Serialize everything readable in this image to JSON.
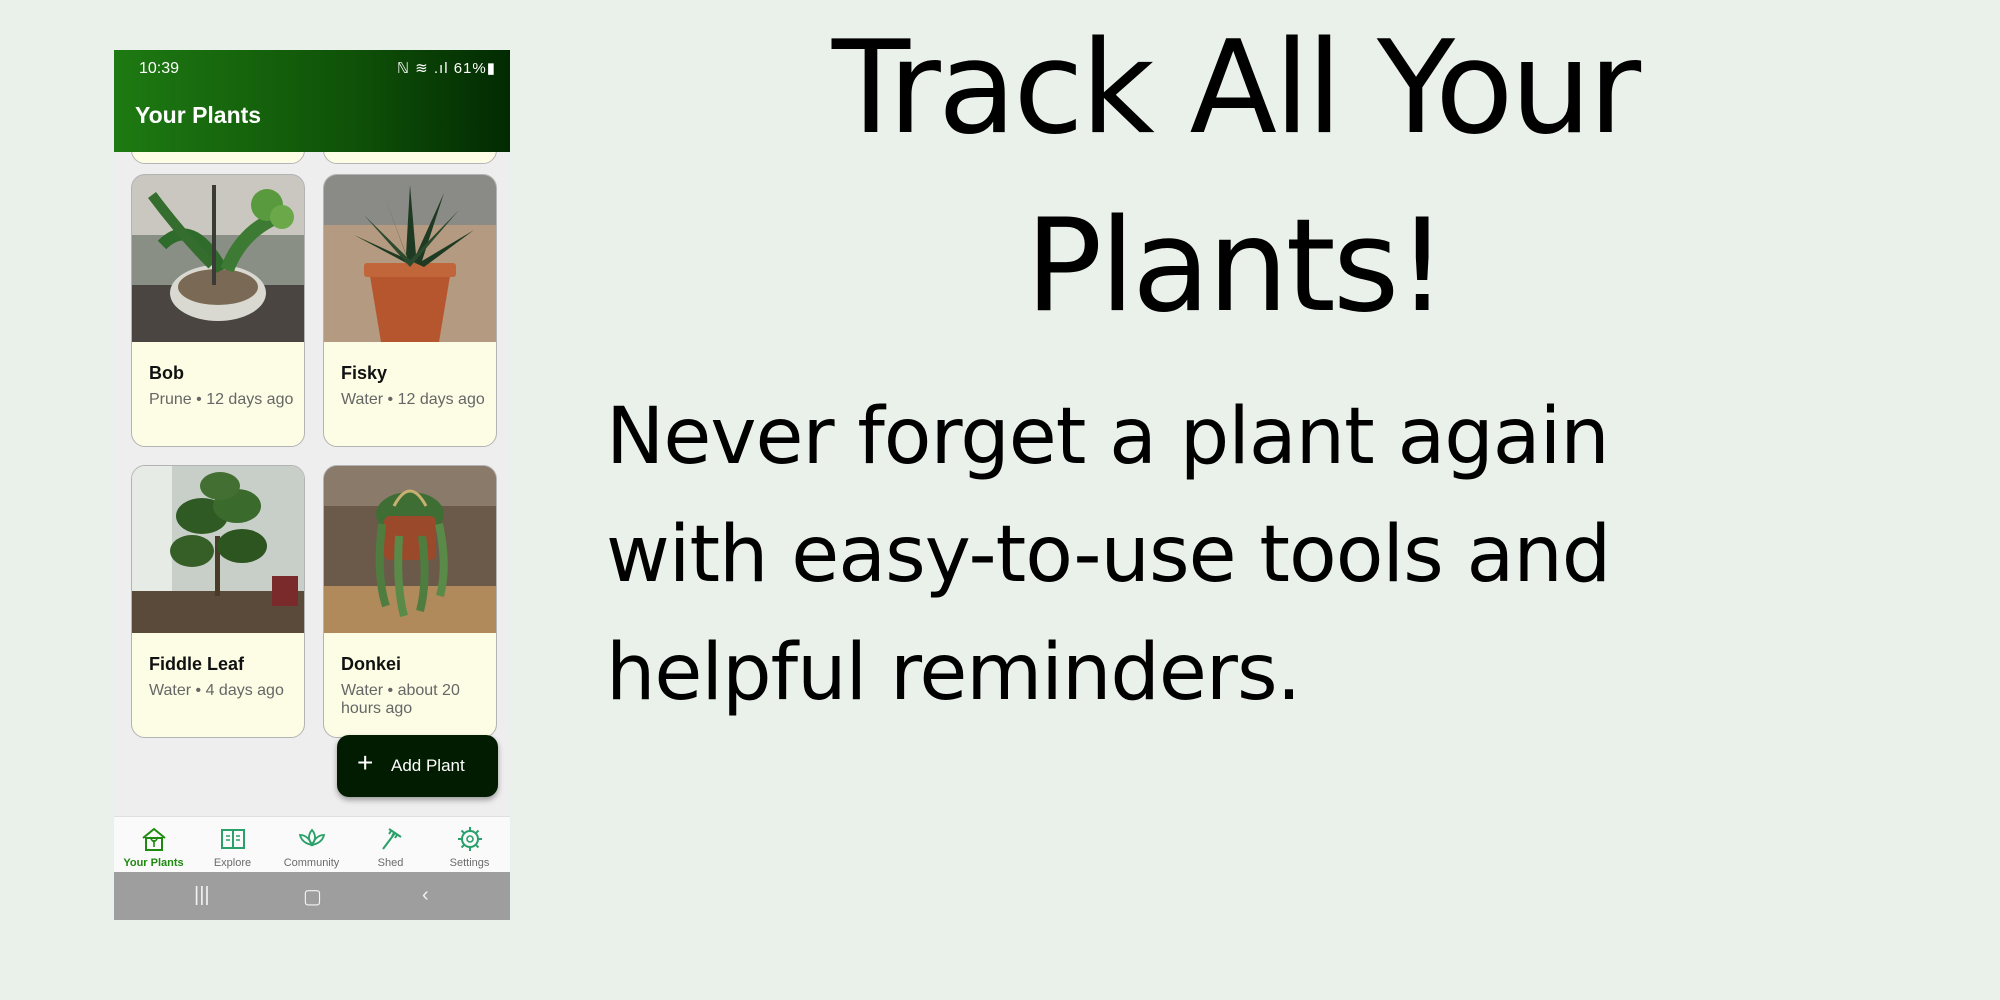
{
  "status_bar": {
    "time": "10:39",
    "icons": "ℕ ≋ .ıl 61%▮"
  },
  "app": {
    "title": "Your Plants"
  },
  "plants": [
    {
      "name": "Bob",
      "subtitle": "Prune • 12 days ago"
    },
    {
      "name": "Fisky",
      "subtitle": "Water • 12 days ago"
    },
    {
      "name": "Fiddle Leaf",
      "subtitle": "Water • 4 days ago"
    },
    {
      "name": "Donkei",
      "subtitle": "Water • about 20 hours ago"
    }
  ],
  "fab": {
    "icon": "+",
    "label": "Add Plant"
  },
  "nav": [
    {
      "label": "Your Plants",
      "icon": "house-plant-icon",
      "active": true
    },
    {
      "label": "Explore",
      "icon": "book-icon"
    },
    {
      "label": "Community",
      "icon": "lotus-icon"
    },
    {
      "label": "Shed",
      "icon": "rake-icon"
    },
    {
      "label": "Settings",
      "icon": "gear-icon"
    }
  ],
  "system_nav": {
    "recents": "|||",
    "home": "▢",
    "back": "‹"
  },
  "headline": {
    "line1": "Track All Your",
    "line2": "Plants!"
  },
  "subline": {
    "line1": "Never forget a plant again",
    "line2": "with easy-to-use tools and",
    "line3": "helpful reminders."
  },
  "colors": {
    "accent": "#1f8a10",
    "appbar_dark": "#022a02",
    "card_bg": "#fdfde6",
    "fab_bg": "#021c02",
    "page_bg": "#eaf1ea"
  }
}
